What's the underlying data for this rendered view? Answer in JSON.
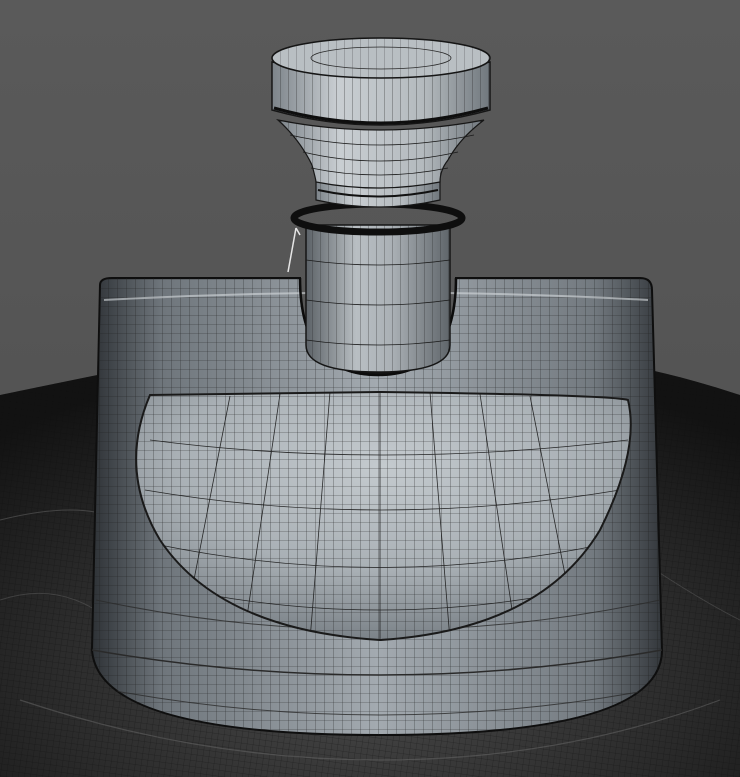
{
  "scene": {
    "subject": "wireframe-render",
    "colors": {
      "background": "#565656",
      "cloth_dark": "#1b1b1b",
      "cloth_mid": "#3a3a3a",
      "body_light": "#b6bcc1",
      "body_mid": "#8f969c",
      "body_dark": "#4c5156",
      "cap_light": "#c3c8cc",
      "cap_mid": "#9aa1a7",
      "wire": "#1c1c1c",
      "ring": "#111111"
    }
  }
}
